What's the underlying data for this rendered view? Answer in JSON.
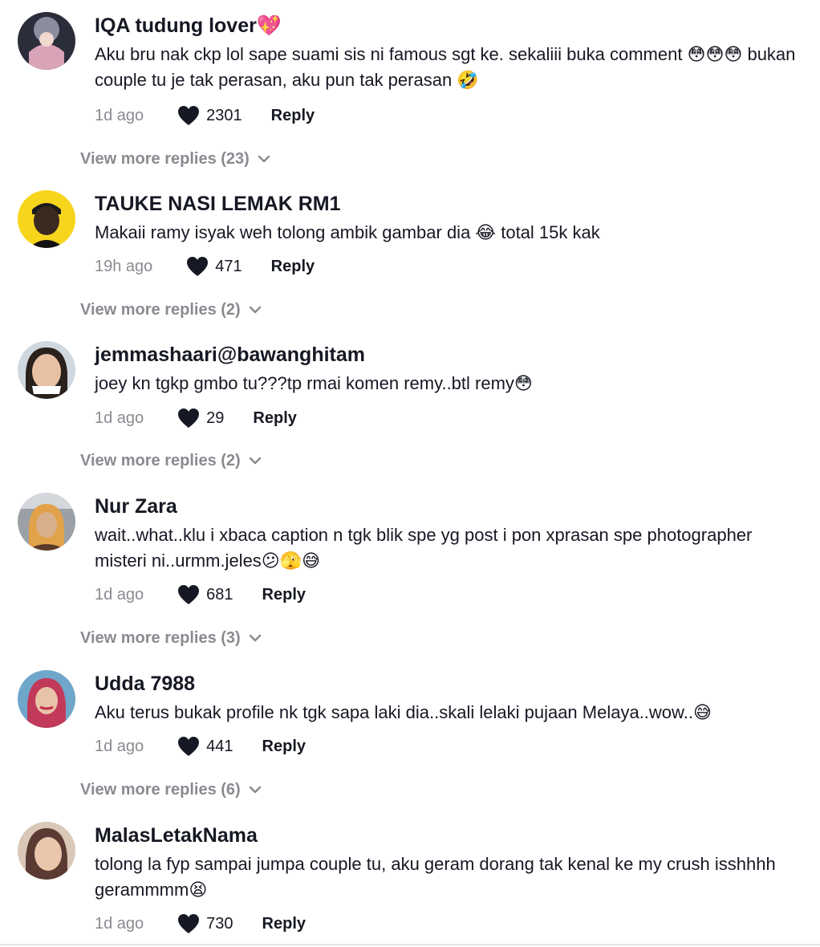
{
  "comments": [
    {
      "username": "IQA tudung lover💖",
      "text": "Aku bru nak ckp lol sape suami sis ni famous sgt ke. sekaliii buka comment 😳😳😳 bukan couple tu je tak perasan, aku pun tak perasan 🤣",
      "time": "1d ago",
      "likes": "2301",
      "reply_label": "Reply",
      "more_replies": "View more replies (23)"
    },
    {
      "username": "TAUKE NASI LEMAK RM1",
      "text": "Makaii ramy isyak weh tolong ambik gambar dia 😂 total 15k kak",
      "time": "19h ago",
      "likes": "471",
      "reply_label": "Reply",
      "more_replies": "View more replies (2)"
    },
    {
      "username": "jemmashaari@bawanghitam",
      "text": "joey kn tgkp gmbo tu???tp rmai komen remy..btl remy😳",
      "time": "1d ago",
      "likes": "29",
      "reply_label": "Reply",
      "more_replies": "View more replies (2)"
    },
    {
      "username": "Nur Zara",
      "text": "wait..what..klu i xbaca caption n tgk blik spe yg post i pon xprasan spe photographer misteri ni..urmm.jeles😕🫣😅",
      "time": "1d ago",
      "likes": "681",
      "reply_label": "Reply",
      "more_replies": "View more replies (3)"
    },
    {
      "username": "Udda 7988",
      "text": "Aku terus bukak profile nk tgk sapa laki dia..skali lelaki pujaan Melaya..wow..😅",
      "time": "1d ago",
      "likes": "441",
      "reply_label": "Reply",
      "more_replies": "View more replies (6)"
    },
    {
      "username": "MalasLetakNama",
      "text": "tolong la fyp sampai jumpa couple tu, aku geram dorang tak kenal ke my crush isshhhh gerammmm😫",
      "time": "1d ago",
      "likes": "730",
      "reply_label": "Reply"
    }
  ],
  "colors": {
    "primary_text": "#161823",
    "secondary_text": "#8a8b91",
    "heart": "#161823",
    "background": "#ffffff"
  },
  "icons": {
    "like": "heart-icon",
    "expand": "chevron-down-icon"
  }
}
